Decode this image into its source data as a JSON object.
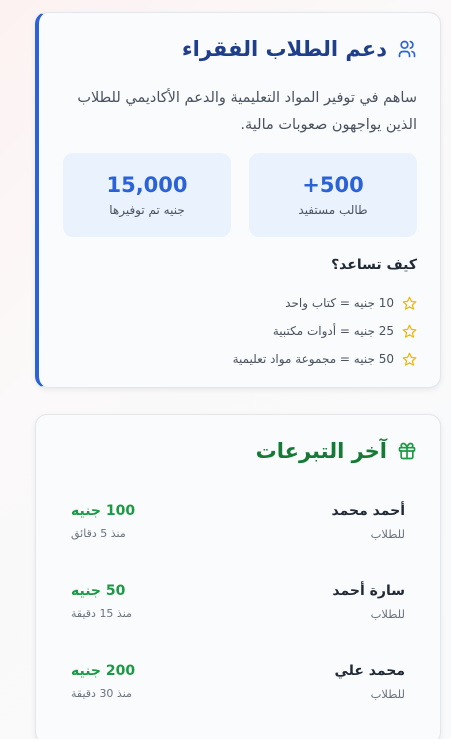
{
  "support": {
    "title": "دعم الطلاب الفقراء",
    "description": "ساهم في توفير المواد التعليمية والدعم الأكاديمي للطلاب الذين يواجهون صعوبات مالية.",
    "stats": [
      {
        "value": "+500",
        "label": "طالب مستفيد"
      },
      {
        "value": "15,000",
        "label": "جنيه تم توفيرها"
      }
    ],
    "help_title": "كيف تساعد؟",
    "help_items": [
      {
        "label": "10 جنيه = كتاب واحد"
      },
      {
        "label": "25 جنيه = أدوات مكتبية"
      },
      {
        "label": "50 جنيه = مجموعة مواد تعليمية"
      }
    ]
  },
  "donations": {
    "title": "آخر التبرعات",
    "items": [
      {
        "name": "أحمد محمد",
        "purpose": "للطلاب",
        "amount": "100 جنيه",
        "time": "منذ 5 دقائق"
      },
      {
        "name": "سارة أحمد",
        "purpose": "للطلاب",
        "amount": "50 جنيه",
        "time": "منذ 15 دقيقة"
      },
      {
        "name": "محمد علي",
        "purpose": "للطلاب",
        "amount": "200 جنيه",
        "time": "منذ 30 دقيقة"
      }
    ]
  },
  "colors": {
    "primary_blue": "#2b63d6",
    "title_blue": "#1f3f8a",
    "green": "#1b9a45",
    "star": "#f2b705"
  },
  "icons": {
    "support": "users-icon",
    "donations": "gift-icon",
    "help_item": "star-icon"
  }
}
